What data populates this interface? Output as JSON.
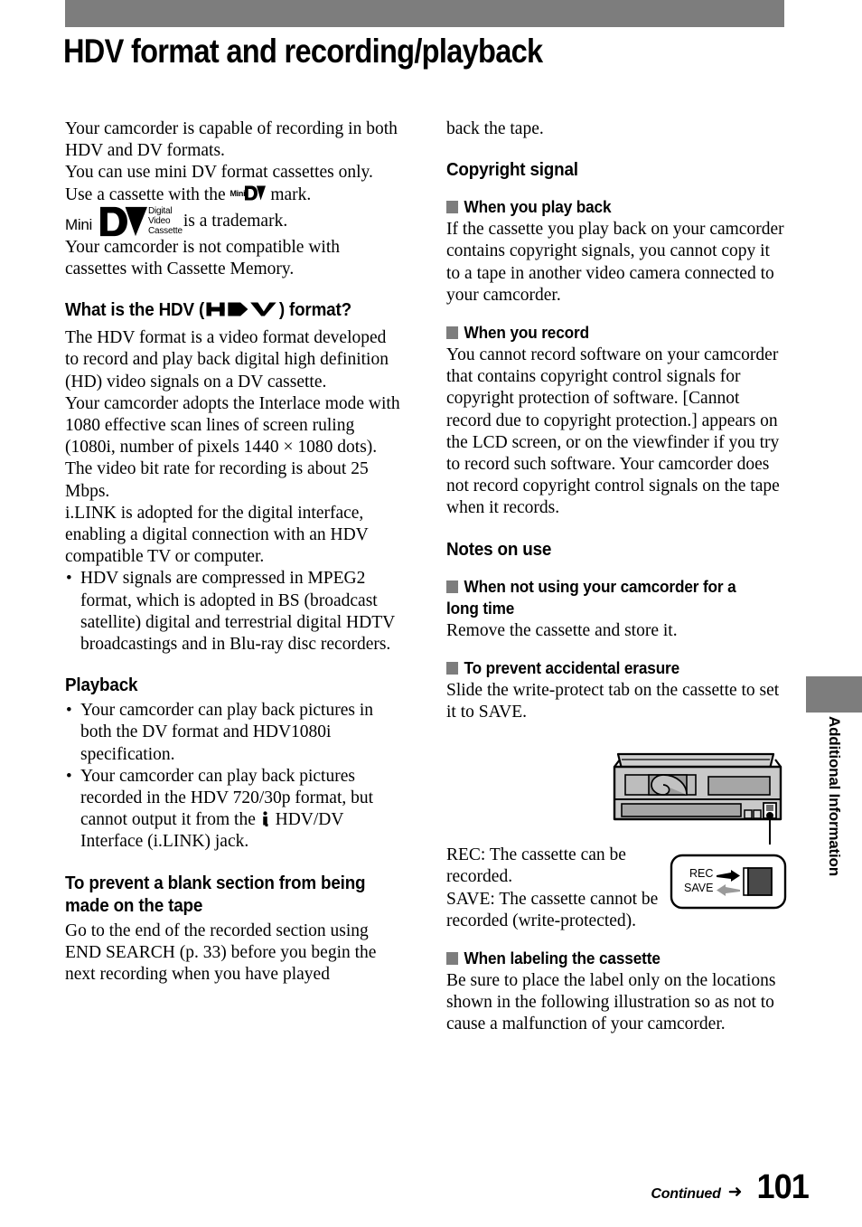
{
  "page": {
    "title": "HDV format and recording/playback",
    "number": "101",
    "continued_label": "Continued",
    "side_tab_label": "Additional Information",
    "accent_gray": "#7d7d7d"
  },
  "left_column": {
    "intro": {
      "line1": "Your camcorder is capable of recording in both HDV and DV formats.",
      "line2": "You can use mini DV format cassettes only.",
      "line3_before_mark": "Use a cassette with the ",
      "line3_after_mark": " mark.",
      "trademark_after_logo": " is a trademark.",
      "line5": "Your camcorder is not compatible with cassettes with Cassette Memory."
    },
    "minidv_logo": {
      "mini": "Mini",
      "dv": "DV",
      "sub_line1": "Digital",
      "sub_line2": "Video",
      "sub_line3": "Cassette"
    },
    "hdv_heading": {
      "before_logo": "What is the HDV (",
      "logo": "HDV",
      "after_logo": ") format?"
    },
    "hdv_body": {
      "p1": "The HDV format is a video format developed to record and play back digital high definition (HD) video signals on a DV cassette.",
      "p2": "Your camcorder adopts the Interlace mode with 1080 effective scan lines of screen ruling (1080i, number of pixels 1440 × 1080 dots).",
      "p3": "The video bit rate for recording is about 25 Mbps.",
      "p4": "i.LINK is adopted for the digital interface, enabling a digital connection with an HDV compatible TV or computer.",
      "bullets": [
        "HDV signals are compressed in MPEG2 format, which is adopted in BS (broadcast satellite) digital and terrestrial digital HDTV broadcastings and in Blu-ray disc recorders."
      ]
    },
    "playback": {
      "heading": "Playback",
      "bullet1": "Your camcorder can play back pictures in both the DV format and HDV1080i specification.",
      "bullet2_part1": "Your camcorder can play back pictures recorded in the HDV 720/30p format, but cannot output it from the ",
      "bullet2_part2": " HDV/DV Interface (i.LINK) jack."
    },
    "blank_section": {
      "heading": "To prevent a blank section from being made on the tape",
      "body": "Go to the end of the recorded section using END SEARCH (p. 33) before you begin the next recording when you have played"
    }
  },
  "right_column": {
    "continuation": "back the tape.",
    "copyright_signal": {
      "heading": "Copyright signal",
      "sub1_heading": "When you play back",
      "sub1_body": "If the cassette you play back on your camcorder contains copyright signals, you cannot copy it to a tape in another video camera connected to your camcorder.",
      "sub2_heading": "When you record",
      "sub2_body": "You cannot record software on your camcorder that contains copyright control signals for copyright protection of software. [Cannot record due to copyright protection.] appears on the LCD screen, or on the viewfinder if you try to record such software. Your camcorder does not record copyright control signals on the tape when it records."
    },
    "notes_on_use": {
      "heading": "Notes on use",
      "sub1_heading": "When not using your camcorder for a long time",
      "sub1_body": "Remove the cassette and store it.",
      "sub2_heading": "To prevent accidental erasure",
      "sub2_body": "Slide the write-protect tab on the cassette to set it to SAVE.",
      "rec_note": "REC: The cassette can be recorded.",
      "save_note": "SAVE: The cassette cannot be recorded (write-protected).",
      "sub3_heading": "When labeling the cassette",
      "sub3_body": "Be sure to place the label only on the locations shown in the following illustration so as not to cause a malfunction of your camcorder."
    }
  },
  "figure": {
    "cassette_alt": "mini DV cassette with write-protect tab",
    "callout": {
      "rec_label": "REC",
      "save_label": "SAVE"
    }
  }
}
